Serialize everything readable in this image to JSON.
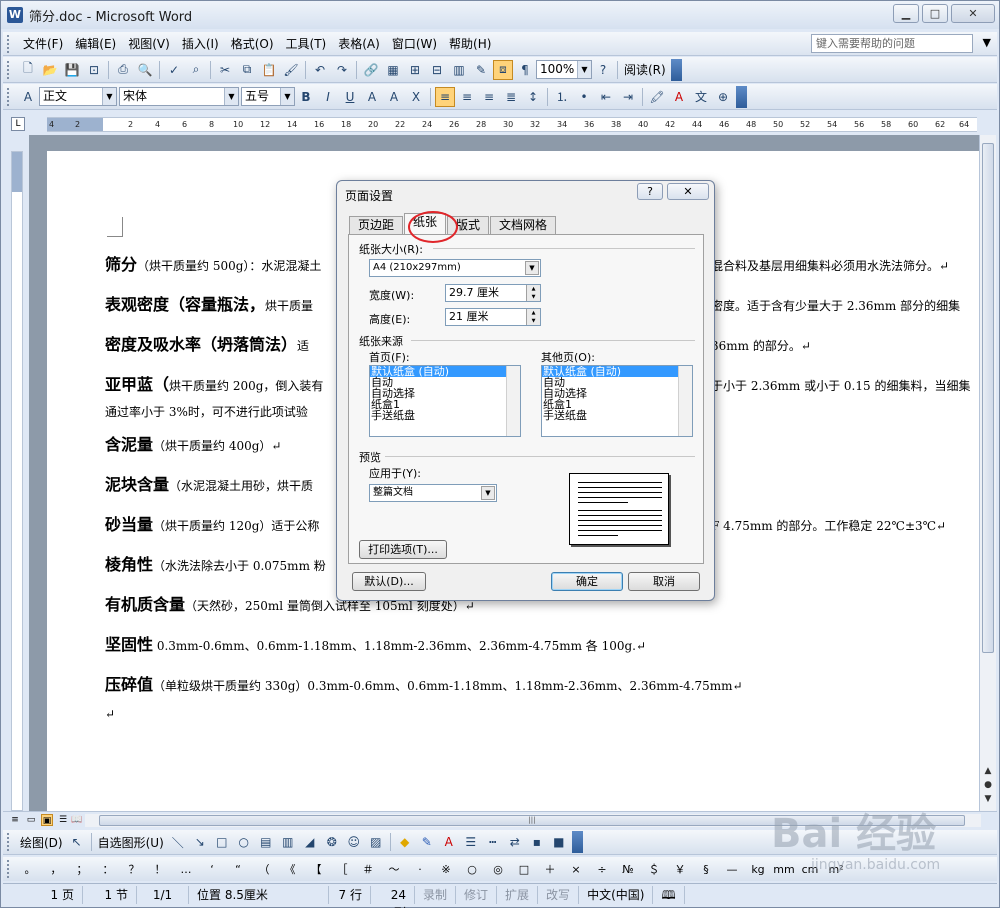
{
  "window": {
    "title": "筛分.doc - Microsoft Word",
    "btn_min": "▁",
    "btn_max": "□",
    "btn_close": "✕"
  },
  "menubar": {
    "items": [
      "文件(F)",
      "编辑(E)",
      "视图(V)",
      "插入(I)",
      "格式(O)",
      "工具(T)",
      "表格(A)",
      "窗口(W)",
      "帮助(H)"
    ],
    "help_placeholder": "键入需要帮助的问题"
  },
  "toolbar": {
    "zoom": "100%",
    "read_button": "阅读(R)",
    "style": "正文",
    "font": "宋体",
    "size": "五号"
  },
  "ruler": {
    "ticks": [
      "4",
      "2",
      "2",
      "4",
      "6",
      "8",
      "10",
      "12",
      "14",
      "16",
      "18",
      "20",
      "22",
      "24",
      "26",
      "28",
      "30",
      "32",
      "34",
      "36",
      "38",
      "40",
      "42",
      "44",
      "46",
      "48",
      "50",
      "52",
      "54",
      "56",
      "58",
      "60",
      "62",
      "64"
    ]
  },
  "document": {
    "paragraphs": [
      {
        "title": "筛分",
        "text": "（烘干质量约 500g）：水泥混凝土",
        "right": "混合料及基层用细集料必须用水洗法筛分。↵"
      },
      {
        "title": "表观密度（容量瓶法，",
        "text": "烘干质量",
        "right": "密度。适于含有少量大于 2.36mm 部分的细集"
      },
      {
        "title": "密度及吸水率（坍落筒法）",
        "text": "适",
        "right": "36mm 的部分。↵"
      },
      {
        "title": "亚甲蓝（",
        "text": "烘干质量约 200g，倒入装有",
        "right": "于小于 2.36mm 或小于 0.15 的细集料，当细集"
      },
      {
        "title": "",
        "text": "通过率小于 3%时，可不进行此项试验",
        "right": ""
      },
      {
        "title": "含泥量",
        "text": "（烘干质量约 400g）↵",
        "right": ""
      },
      {
        "title": "泥块含量",
        "text": "（水泥混凝土用砂，烘干质",
        "right": ""
      },
      {
        "title": "砂当量",
        "text": "（烘干质量约 120g）适于公称",
        "right": "F 4.75mm 的部分。工作稳定 22℃±3℃↵"
      },
      {
        "title": "棱角性",
        "text": "（水洗法除去小于 0.075mm 粉",
        "right": ""
      },
      {
        "title": "有机质含量",
        "text": "（天然砂，250ml 量筒倒入试样至 105ml 刻度处）↵",
        "right": ""
      },
      {
        "title": "坚固性",
        "text": " 0.3mm-0.6mm、0.6mm-1.18mm、1.18mm-2.36mm、2.36mm-4.75mm 各 100g.↵",
        "right": ""
      },
      {
        "title": "压碎值",
        "text": "（单粒级烘干质量约 330g）0.3mm-0.6mm、0.6mm-1.18mm、1.18mm-2.36mm、2.36mm-4.75mm↵",
        "right": ""
      },
      {
        "title": "",
        "text": "↵",
        "right": ""
      }
    ]
  },
  "dialog": {
    "title": "页面设置",
    "help": "?",
    "close": "✕",
    "tabs": [
      "页边距",
      "纸张",
      "版式",
      "文档网格"
    ],
    "paper_size_label": "纸张大小(R):",
    "paper_size_value": "A4 (210x297mm)",
    "width_label": "宽度(W):",
    "width_value": "29.7 厘米",
    "height_label": "高度(E):",
    "height_value": "21 厘米",
    "source_label": "纸张来源",
    "first_page_label": "首页(F):",
    "other_pages_label": "其他页(O):",
    "tray_options": [
      "默认纸盒 (自动)",
      "自动",
      "自动选择",
      "纸盒1",
      "手送纸盘"
    ],
    "preview_label": "预览",
    "apply_label": "应用于(Y):",
    "apply_value": "整篇文档",
    "print_options": "打印选项(T)...",
    "default_btn": "默认(D)...",
    "ok_btn": "确定",
    "cancel_btn": "取消"
  },
  "drawbar": {
    "draw_label": "绘图(D)",
    "autoshape_label": "自选图形(U)"
  },
  "symbols": [
    "。",
    "，",
    "；",
    "：",
    "？",
    "！",
    "…",
    "‘",
    "“",
    "（",
    "《",
    "【",
    "［",
    "＃",
    "～",
    "·",
    "※",
    "○",
    "◎",
    "□",
    "＋",
    "×",
    "÷",
    "№",
    "＄",
    "￥",
    "§",
    "—",
    "kg",
    "mm",
    "cm",
    "m²"
  ],
  "statusbar": {
    "page": "1 页",
    "section": "1 节",
    "pages": "1/1",
    "position": "位置 8.5厘米",
    "line": "7 行",
    "col": "24 列",
    "rec": "录制",
    "trk": "修订",
    "ext": "扩展",
    "ovr": "改写",
    "lang": "中文(中国)"
  },
  "watermark": {
    "main": "Bai 经验",
    "sub": "jingyan.baidu.com"
  }
}
